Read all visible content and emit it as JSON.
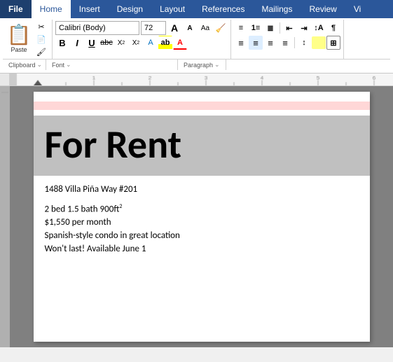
{
  "tabs": [
    {
      "label": "File",
      "active": false
    },
    {
      "label": "Home",
      "active": true
    },
    {
      "label": "Insert",
      "active": false
    },
    {
      "label": "Design",
      "active": false
    },
    {
      "label": "Layout",
      "active": false
    },
    {
      "label": "References",
      "active": false
    },
    {
      "label": "Mailings",
      "active": false
    },
    {
      "label": "Review",
      "active": false
    },
    {
      "label": "Vi",
      "active": false
    }
  ],
  "toolbar": {
    "font_name": "Calibri (Body)",
    "font_size": "72",
    "clipboard_label": "Clipboard",
    "font_label": "Font",
    "paragraph_label": "Paragraph"
  },
  "format_buttons": {
    "bold": "B",
    "italic": "I",
    "underline": "U",
    "strikethrough": "ab",
    "subscript": "X₂",
    "superscript": "X²"
  },
  "document": {
    "for_rent": "For Rent",
    "address": "1488 Villa Piña Way #201",
    "bed_bath": "2 bed 1.5 bath 900ft",
    "superscript": "2",
    "price": "$1,550 per month",
    "description": "Spanish-style condo in great location",
    "availability": "Won't last! Available June 1"
  }
}
